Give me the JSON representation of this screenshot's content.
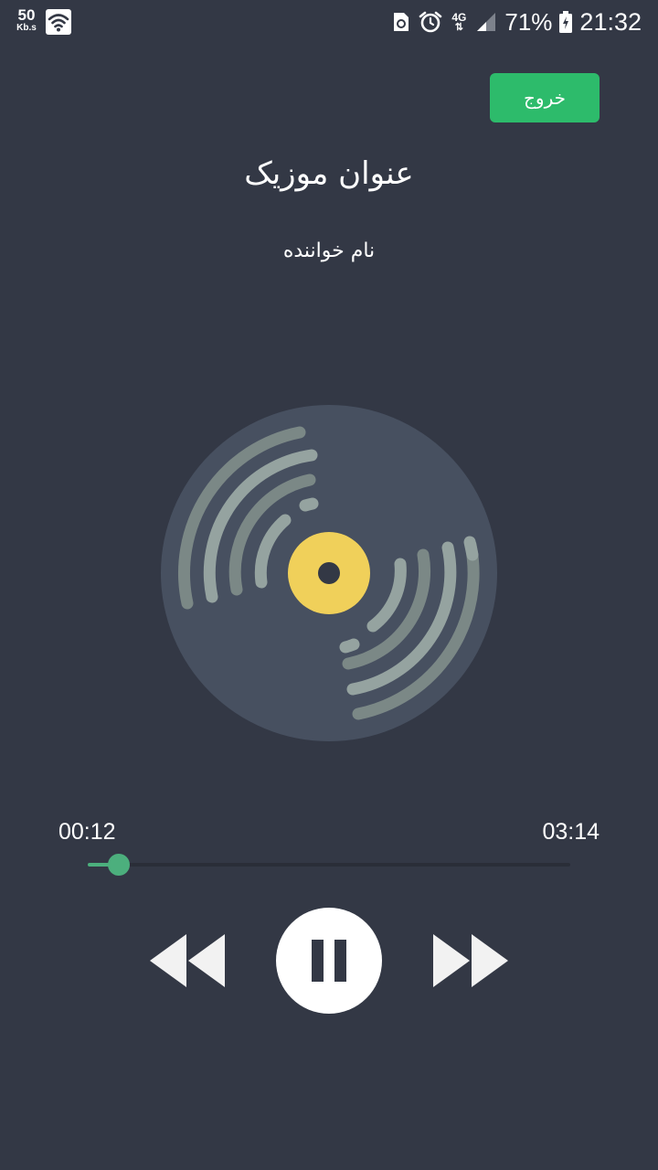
{
  "status_bar": {
    "net_speed_value": "50",
    "net_speed_unit": "Kb.s",
    "network_type": "4G",
    "battery_percent": "71%",
    "time": "21:32"
  },
  "header": {
    "exit_label": "خروج"
  },
  "track": {
    "title": "عنوان موزیک",
    "artist": "نام خواننده"
  },
  "player": {
    "current_time": "00:12",
    "total_time": "03:14",
    "progress_fraction": 0.064,
    "state": "playing"
  },
  "colors": {
    "background": "#333845",
    "accent": "#2dbb6b",
    "progress": "#4caf7d",
    "disc": "#475060",
    "disc_label": "#f0d05a"
  },
  "icons": [
    "wifi-icon",
    "sim-icon",
    "alarm-icon",
    "signal-icon",
    "battery-icon",
    "vinyl-disc-icon",
    "rewind-icon",
    "pause-icon",
    "fast-forward-icon"
  ]
}
